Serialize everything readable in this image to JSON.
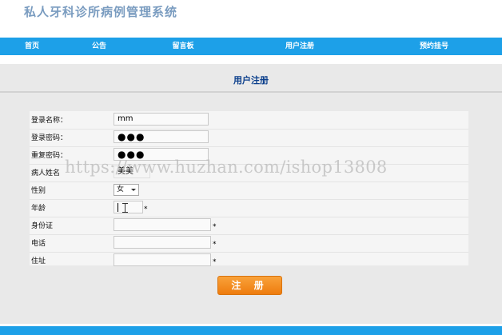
{
  "site": {
    "title": "私人牙科诊所病例管理系统"
  },
  "nav": {
    "items": [
      {
        "label": "首页"
      },
      {
        "label": "公告"
      },
      {
        "label": "留言板"
      },
      {
        "label": "用户注册"
      },
      {
        "label": "预约挂号"
      }
    ]
  },
  "section": {
    "title": "用户注册"
  },
  "form": {
    "fields": [
      {
        "label": "登录名称：",
        "value": "mm"
      },
      {
        "label": "登录密码：",
        "value": "●●●"
      },
      {
        "label": "重复密码：",
        "value": "●●●"
      },
      {
        "label": "病人姓名",
        "value": "美美"
      },
      {
        "label": "性别",
        "value": "女"
      },
      {
        "label": "年龄",
        "value": ""
      },
      {
        "label": "身份证",
        "value": ""
      },
      {
        "label": "电话",
        "value": ""
      },
      {
        "label": "住址",
        "value": ""
      }
    ],
    "required_mark": "*",
    "submit_label": "注 册"
  },
  "watermark": {
    "text": "https://www.huzhan.com/ishop13808"
  },
  "colors": {
    "nav_bg": "#1da0e8",
    "submit_bg": "#f39326",
    "title_color": "#0b3f8c"
  }
}
